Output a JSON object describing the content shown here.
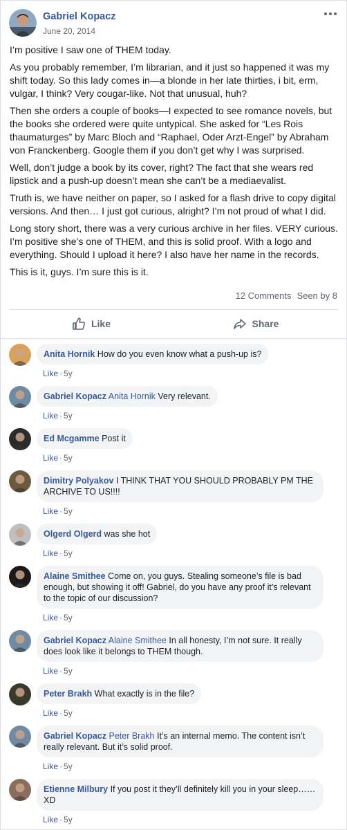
{
  "post": {
    "author": "Gabriel Kopacz",
    "date": "June 20, 2014",
    "paragraphs": [
      "I’m positive I saw one of THEM today.",
      "As you probably remember, I’m librarian, and it just so happened it was my shift today. So this lady comes in—a blonde in her late thirties, i bit, erm, vulgar, I think? Very cougar-like. Not that unusual, huh?",
      "Then she orders a couple of books—I expected to see romance novels, but the books she ordered were quite untypical. She asked for “Les Rois thaumaturges” by Marc Bloch and “Raphael, Oder Arzt-Engel” by Abraham von Franckenberg. Google them if you don’t get why I was surprised.",
      "Well, don’t judge a book by its cover, right? The fact that she wears red lipstick and a push-up doesn’t mean she can’t be a mediaevalist.",
      "Truth is, we have neither on paper, so I asked for a flash drive to copy digital versions. And then… I just got curious, alright? I’m not proud of what I did.",
      "Long story short, there was a very curious archive in her files. VERY curious. I’m positive she’s one of THEM, and this is solid proof. With a logo and everything. Should I upload it here? I also have her name in the records.",
      "This is it, guys. I’m sure this is it."
    ],
    "comments_count": "12 Comments",
    "seen_by": "Seen by 8",
    "like_label": "Like",
    "share_label": "Share"
  },
  "comments": [
    {
      "name": "Anita Hornik",
      "tag": "",
      "text": "How do you even know what a push-up is?",
      "like": "Like",
      "age": "5y",
      "avatar_color": "#d9a15a"
    },
    {
      "name": "Gabriel Kopacz",
      "tag": "Anita Hornik",
      "text": "Very relevant.",
      "like": "Like",
      "age": "5y",
      "avatar_color": "#6f8ba3"
    },
    {
      "name": "Ed Mcgamme",
      "tag": "",
      "text": "Post it",
      "like": "Like",
      "age": "5y",
      "avatar_color": "#2b2b2b"
    },
    {
      "name": "Dimitry Polyakov",
      "tag": "",
      "text": "I THINK THAT YOU SHOULD PROBABLY PM THE ARCHIVE TO US!!!!",
      "like": "Like",
      "age": "5y",
      "avatar_color": "#6b5a3e"
    },
    {
      "name": "Olgerd Olgerd",
      "tag": "",
      "text": "was she hot",
      "like": "Like",
      "age": "5y",
      "avatar_color": "#bfbfbf"
    },
    {
      "name": "Alaine Smithee",
      "tag": "",
      "text": "Come on, you guys. Stealing someone’s file is bad enough, but showing it off! Gabriel, do you have any proof it’s relevant to the topic of our discussion?",
      "like": "Like",
      "age": "5y",
      "avatar_color": "#1a1a1a"
    },
    {
      "name": "Gabriel Kopacz",
      "tag": "Alaine Smithee",
      "text": "In all honesty, I’m not sure. It really does look like it belongs to THEM though.",
      "like": "Like",
      "age": "5y",
      "avatar_color": "#6f8ba3"
    },
    {
      "name": "Peter Brakh",
      "tag": "",
      "text": "What exactly is in the file?",
      "like": "Like",
      "age": "5y",
      "avatar_color": "#3a3a2a"
    },
    {
      "name": "Gabriel Kopacz",
      "tag": "Peter Brakh",
      "text": "It’s an internal memo. The content isn’t really relevant. But it’s solid proof.",
      "like": "Like",
      "age": "5y",
      "avatar_color": "#6f8ba3"
    },
    {
      "name": "Etienne Milbury",
      "tag": "",
      "text": "If you post it they’ll definitely kill you in your sleep…… XD",
      "like": "Like",
      "age": "5y",
      "avatar_color": "#8a6d5c"
    }
  ]
}
